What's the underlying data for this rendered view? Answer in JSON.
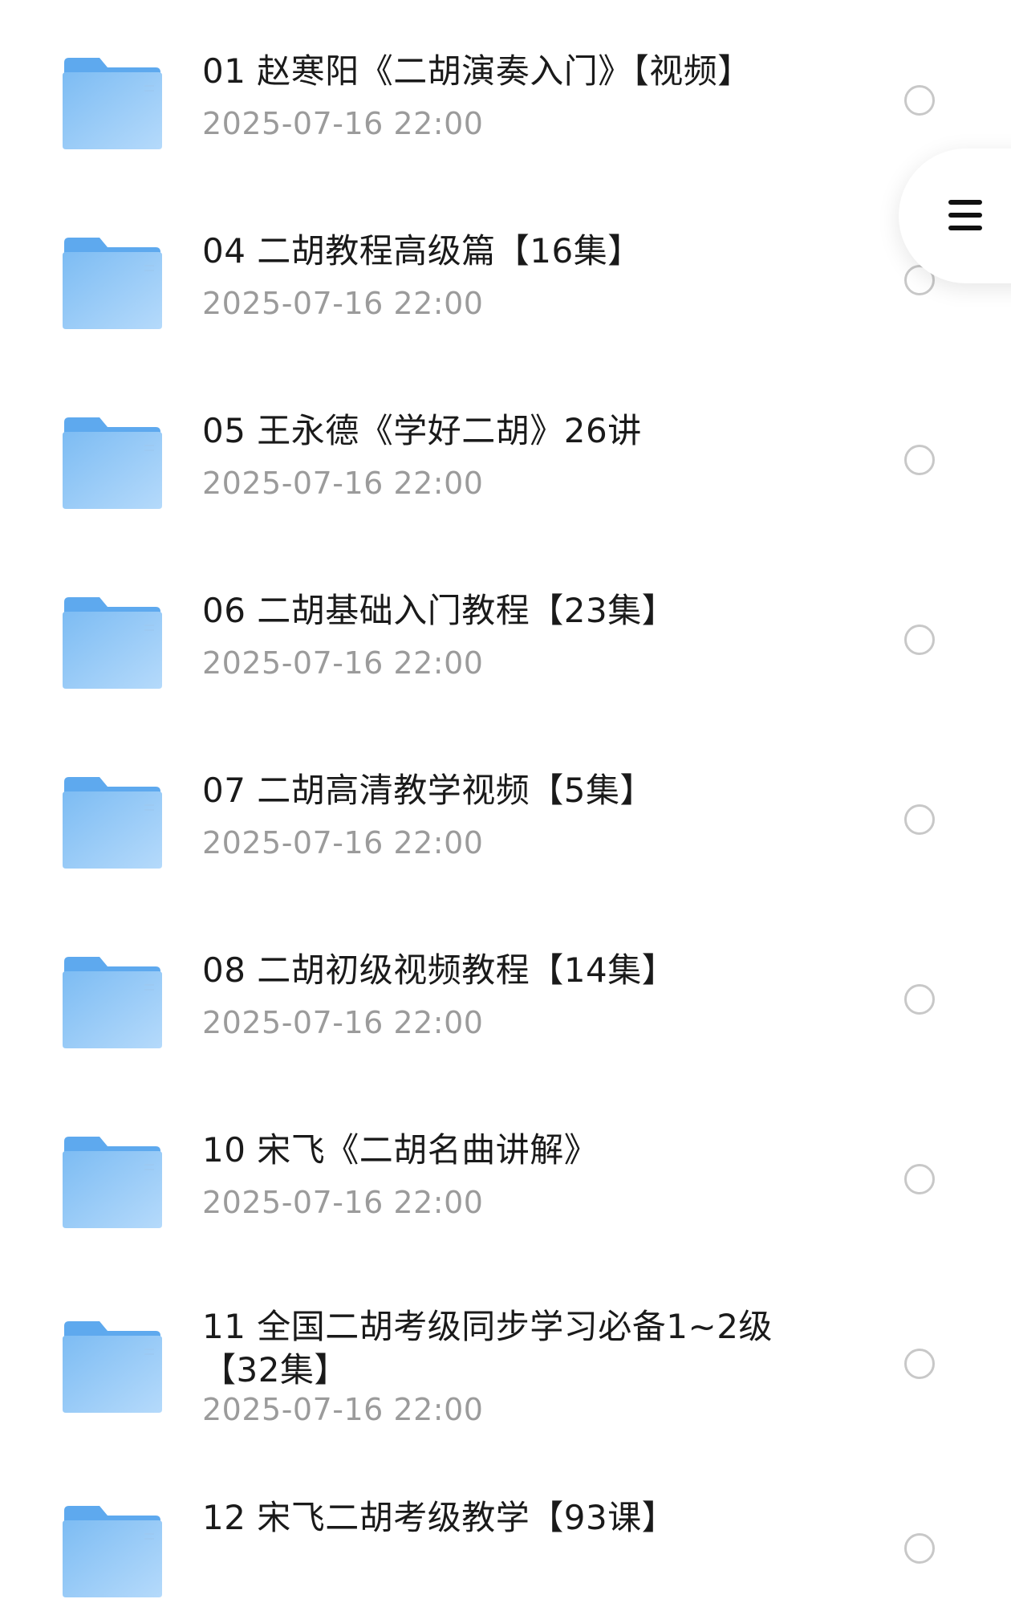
{
  "colors": {
    "folder_back": "#5ea9ee",
    "folder_front_top": "#7dbcf3",
    "folder_front_bottom": "#b5dafb",
    "title_text": "#1a1a1a",
    "date_text": "#9b9b9b",
    "radio_border": "#c8c8c8"
  },
  "menu_button": {
    "icon": "hamburger-menu-icon"
  },
  "items": [
    {
      "title": "01 赵寒阳《二胡演奏入门》【视频】",
      "date": "2025-07-16 22:00",
      "selected": false
    },
    {
      "title": "04 二胡教程高级篇【16集】",
      "date": "2025-07-16 22:00",
      "selected": false
    },
    {
      "title": "05 王永德《学好二胡》26讲",
      "date": "2025-07-16 22:00",
      "selected": false
    },
    {
      "title": "06 二胡基础入门教程【23集】",
      "date": "2025-07-16 22:00",
      "selected": false
    },
    {
      "title": "07 二胡高清教学视频【5集】",
      "date": "2025-07-16 22:00",
      "selected": false
    },
    {
      "title": "08 二胡初级视频教程【14集】",
      "date": "2025-07-16 22:00",
      "selected": false
    },
    {
      "title": "10 宋飞《二胡名曲讲解》",
      "date": "2025-07-16 22:00",
      "selected": false
    },
    {
      "title": "11 全国二胡考级同步学习必备1~2级\n【32集】",
      "date": "2025-07-16 22:00",
      "selected": false
    },
    {
      "title": "12 宋飞二胡考级教学【93课】",
      "date": "",
      "selected": false
    }
  ]
}
